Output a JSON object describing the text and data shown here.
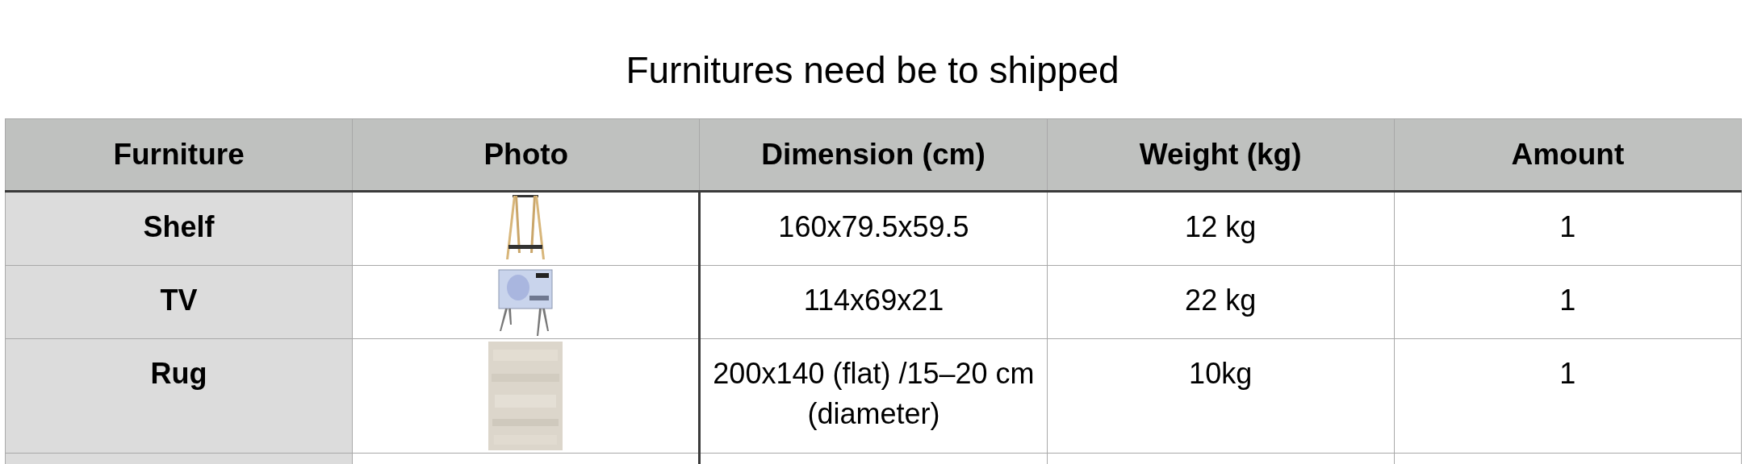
{
  "title": "Furnitures need be to shipped",
  "table": {
    "columns": [
      "Furniture",
      "Photo",
      "Dimension (cm)",
      "Weight (kg)",
      "Amount"
    ],
    "rows": [
      {
        "furniture": "Shelf",
        "dimension": "160x79.5x59.5",
        "weight": "12 kg",
        "amount": "1"
      },
      {
        "furniture": "TV",
        "dimension": "114x69x21",
        "weight": "22 kg",
        "amount": "1"
      },
      {
        "furniture": "Rug",
        "dimension": "200x140 (flat) /15–20 cm (diameter)",
        "weight": "10kg",
        "amount": "1"
      }
    ]
  }
}
